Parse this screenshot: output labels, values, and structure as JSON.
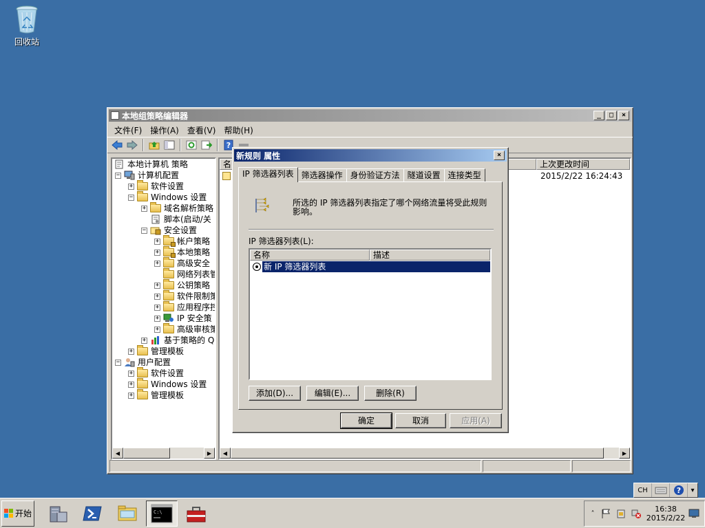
{
  "desktop": {
    "recycle_bin_label": "回收站"
  },
  "mmc": {
    "title": "本地组策略编辑器",
    "menu": [
      "文件(F)",
      "操作(A)",
      "查看(V)",
      "帮助(H)"
    ],
    "tree": [
      {
        "label": "本地计算机 策略",
        "pm": "",
        "icon": "policy-icon"
      },
      {
        "label": "计算机配置",
        "pm": "⊟",
        "icon": "computer-icon"
      },
      {
        "label": "软件设置",
        "pm": "⊞",
        "icon": "folder-icon"
      },
      {
        "label": "Windows 设置",
        "pm": "⊟",
        "icon": "folder-icon"
      },
      {
        "label": "域名解析策略",
        "pm": "⊞",
        "icon": "folder-icon"
      },
      {
        "label": "脚本(启动/关",
        "pm": "",
        "icon": "script-icon"
      },
      {
        "label": "安全设置",
        "pm": "⊟",
        "icon": "security-icon"
      },
      {
        "label": "帐户策略",
        "pm": "⊞",
        "icon": "folder-lock-icon"
      },
      {
        "label": "本地策略",
        "pm": "⊞",
        "icon": "folder-lock-icon"
      },
      {
        "label": "高级安全",
        "pm": "⊞",
        "icon": "folder-icon"
      },
      {
        "label": "网络列表管",
        "pm": "",
        "icon": "folder-icon"
      },
      {
        "label": "公钥策略",
        "pm": "⊞",
        "icon": "folder-icon"
      },
      {
        "label": "软件限制策",
        "pm": "⊞",
        "icon": "folder-icon"
      },
      {
        "label": "应用程序控",
        "pm": "⊞",
        "icon": "folder-icon"
      },
      {
        "label": "IP 安全策",
        "pm": "⊞",
        "icon": "ipsec-icon"
      },
      {
        "label": "高级审核策",
        "pm": "⊞",
        "icon": "folder-icon"
      },
      {
        "label": "基于策略的 Q",
        "pm": "⊞",
        "icon": "chart-icon"
      },
      {
        "label": "管理模板",
        "pm": "⊞",
        "icon": "folder-icon"
      },
      {
        "label": "用户配置",
        "pm": "⊟",
        "icon": "user-icon"
      },
      {
        "label": "软件设置",
        "pm": "⊞",
        "icon": "folder-icon"
      },
      {
        "label": "Windows 设置",
        "pm": "⊞",
        "icon": "folder-icon"
      },
      {
        "label": "管理模板",
        "pm": "⊞",
        "icon": "folder-icon"
      }
    ],
    "right_columns": {
      "name": "名",
      "modified": "上次更改时间"
    },
    "right_rows": [
      {
        "modified": "2015/2/22 16:24:43"
      }
    ]
  },
  "dialog": {
    "title": "新规则 属性",
    "tabs": [
      "IP 筛选器列表",
      "筛选器操作",
      "身份验证方法",
      "隧道设置",
      "连接类型"
    ],
    "description": "所选的 IP 筛选器列表指定了哪个网络流量将受此规则影响。",
    "list_label": "IP 筛选器列表(L):",
    "columns": [
      "名称",
      "描述"
    ],
    "rows": [
      {
        "name": "新 IP 筛选器列表",
        "desc": "",
        "selected": true
      }
    ],
    "buttons": {
      "add": "添加(D)...",
      "edit": "编辑(E)...",
      "remove": "删除(R)",
      "ok": "确定",
      "cancel": "取消",
      "apply": "应用(A)"
    }
  },
  "taskbar": {
    "start_label": "开始",
    "lang": "CH",
    "time": "16:38",
    "date": "2015/2/22"
  }
}
